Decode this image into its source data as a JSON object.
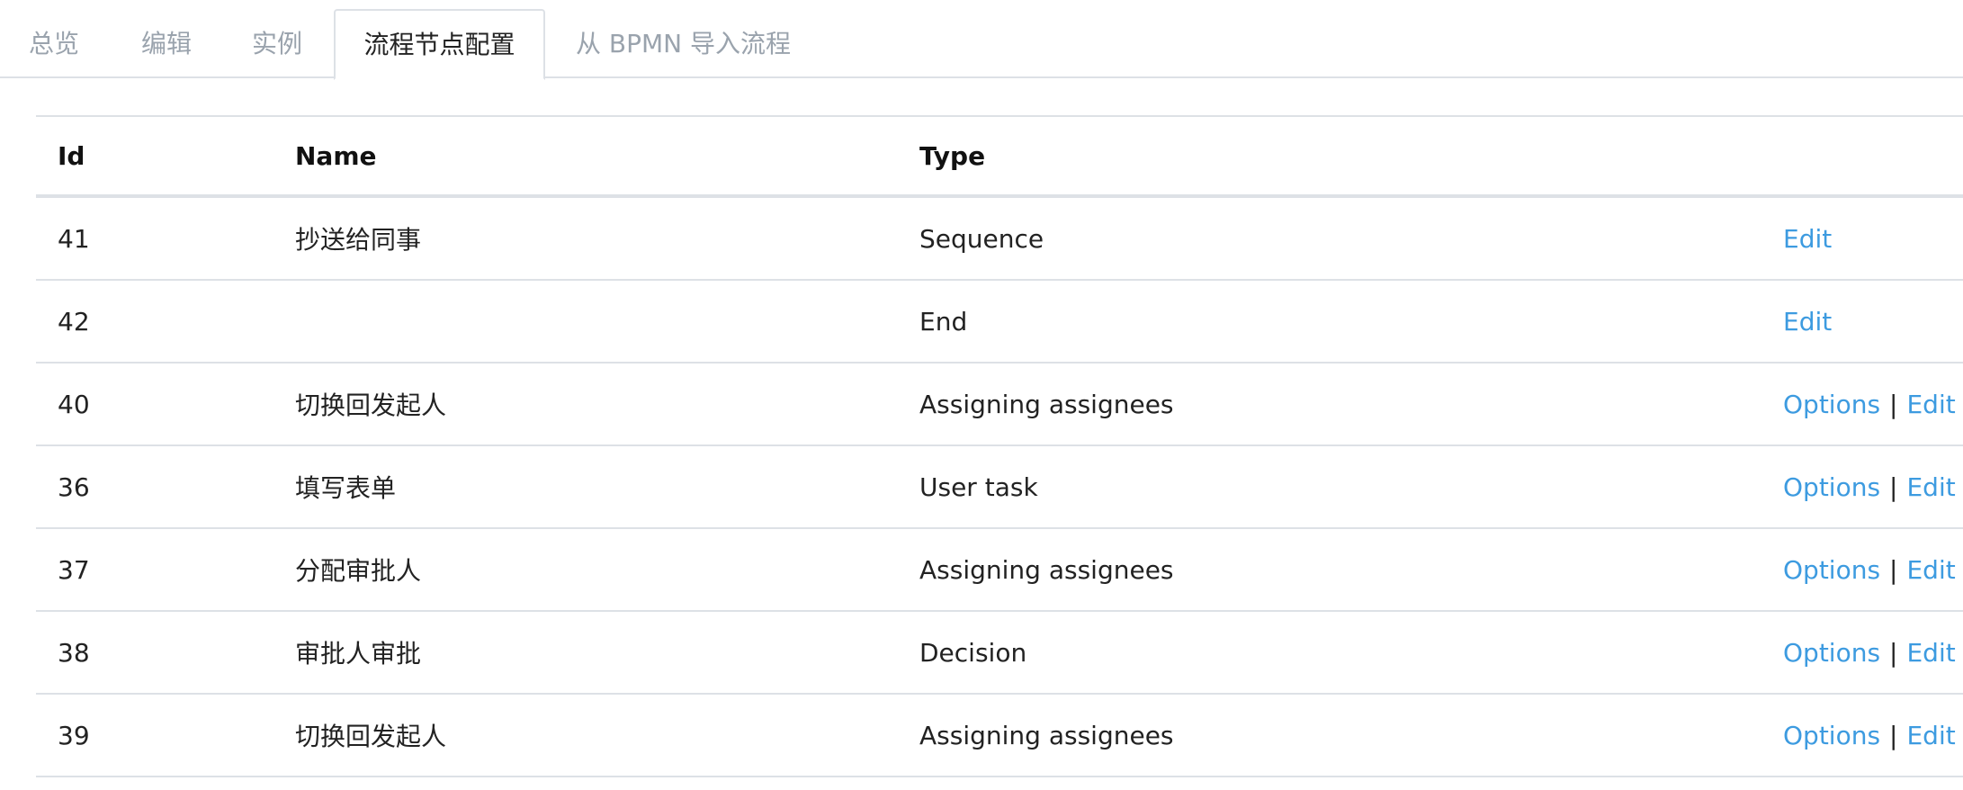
{
  "tabs": [
    {
      "label": "总览"
    },
    {
      "label": "编辑"
    },
    {
      "label": "实例"
    },
    {
      "label": "流程节点配置",
      "active": true
    },
    {
      "label": "从 BPMN 导入流程"
    }
  ],
  "table": {
    "headers": {
      "id": "Id",
      "name": "Name",
      "type": "Type"
    },
    "rows": [
      {
        "id": "41",
        "name": "抄送给同事",
        "type": "Sequence",
        "options": "",
        "edit": "Edit"
      },
      {
        "id": "42",
        "name": "",
        "type": "End",
        "options": "",
        "edit": "Edit"
      },
      {
        "id": "40",
        "name": "切换回发起人",
        "type": "Assigning assignees",
        "options": "Options",
        "edit": "Edit"
      },
      {
        "id": "36",
        "name": "填写表单",
        "type": "User task",
        "options": "Options",
        "edit": "Edit"
      },
      {
        "id": "37",
        "name": "分配审批人",
        "type": "Assigning assignees",
        "options": "Options",
        "edit": "Edit"
      },
      {
        "id": "38",
        "name": "审批人审批",
        "type": "Decision",
        "options": "Options",
        "edit": "Edit"
      },
      {
        "id": "39",
        "name": "切换回发起人",
        "type": "Assigning assignees",
        "options": "Options",
        "edit": "Edit"
      }
    ],
    "separator": "|"
  },
  "colors": {
    "link": "#3d9be0",
    "muted_tab": "#9aa3ad",
    "border": "#dde1e6"
  }
}
